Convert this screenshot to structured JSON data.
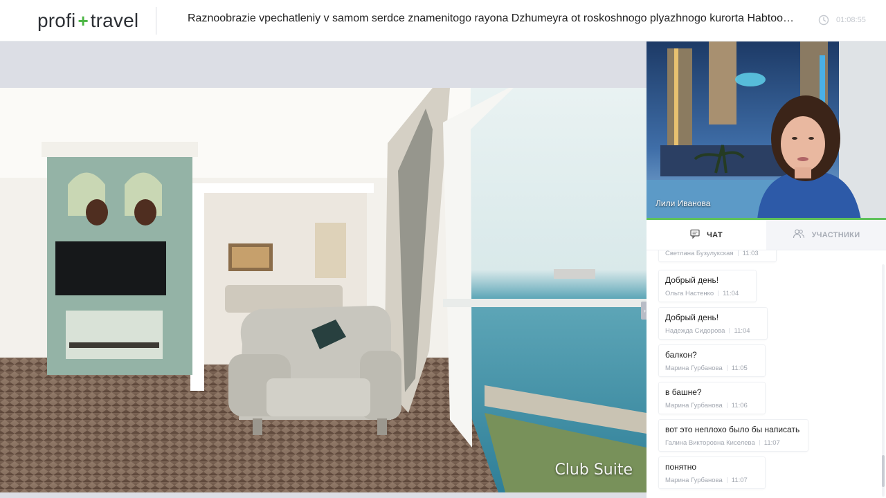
{
  "header": {
    "logo_part1": "profi",
    "logo_plus": "+",
    "logo_part2": "travel",
    "title": "Raznoobrazie vpechatleniy v samom serdce znamenitogo rayona Dzhumeyra ot roskoshnogo plyazhnogo kurorta Habtoor Grand Resort, Autograph Collection",
    "elapsed_time": "01:08:55"
  },
  "video": {
    "caption": "Club Suite"
  },
  "presenter": {
    "name": "Лили Иванова"
  },
  "tabs": [
    {
      "label": "ЧАТ",
      "icon": "chat-icon",
      "active": true
    },
    {
      "label": "УЧАСТНИКИ",
      "icon": "participants-icon",
      "active": false
    }
  ],
  "chat": {
    "messages": [
      {
        "text": "",
        "author": "Светлана Бузулукская",
        "time": "11:03"
      },
      {
        "text": "Добрый день!",
        "author": "Ольга Настенко",
        "time": "11:04"
      },
      {
        "text": "Добрый день!",
        "author": "Надежда Сидорова",
        "time": "11:04"
      },
      {
        "text": "балкон?",
        "author": "Марина Гурбанова",
        "time": "11:05"
      },
      {
        "text": "в башне?",
        "author": "Марина Гурбанова",
        "time": "11:06"
      },
      {
        "text": "вот это неплохо было бы написать",
        "author": "Галина Викторовна Киселева",
        "time": "11:07"
      },
      {
        "text": "понятно",
        "author": "Марина Гурбанова",
        "time": "11:07"
      }
    ]
  },
  "colors": {
    "accent_green": "#4bb543",
    "cam_bar_green": "#5fc25a",
    "stage_background": "#dcdee5"
  }
}
